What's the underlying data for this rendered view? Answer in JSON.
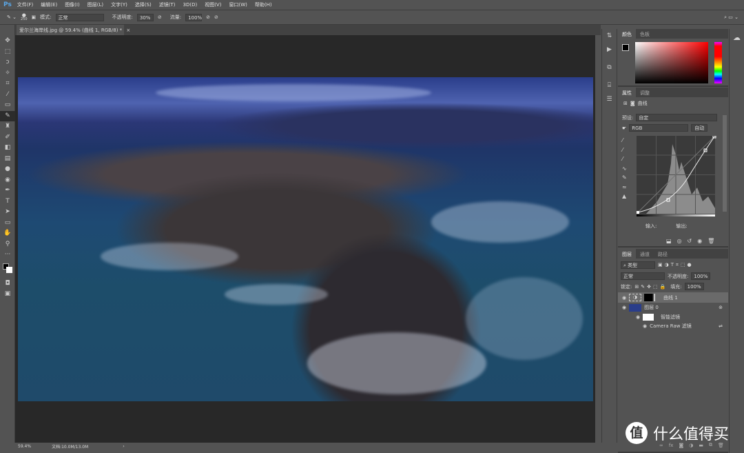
{
  "app": {
    "logo": "Ps"
  },
  "menu": [
    "文件(F)",
    "编辑(E)",
    "图像(I)",
    "图层(L)",
    "文字(Y)",
    "选择(S)",
    "滤镜(T)",
    "3D(D)",
    "视图(V)",
    "窗口(W)",
    "帮助(H)"
  ],
  "options": {
    "brush_size": "250",
    "mode_label": "模式:",
    "mode_value": "正常",
    "opacity_label": "不透明度:",
    "opacity_value": "30%",
    "flow_label": "流量:",
    "flow_value": "100%"
  },
  "document": {
    "tab_title": "爱尔兰海岸线.jpg @ 59.4% (曲线 1, RGB/8) *",
    "close": "×"
  },
  "status": {
    "zoom": "59.4%",
    "doc": "文档:10.0M/13.0M",
    "arrow": "›"
  },
  "color_panel": {
    "tabs": [
      "颜色",
      "色板"
    ]
  },
  "properties": {
    "tabs": [
      "属性",
      "调整"
    ],
    "title": "曲线",
    "preset_label": "预设:",
    "preset_value": "自定",
    "channel": "RGB",
    "auto": "自动",
    "input_label": "输入:",
    "output_label": "输出:"
  },
  "layers_panel": {
    "tabs": [
      "图层",
      "通道",
      "路径"
    ],
    "filter": "类型",
    "blend": "正常",
    "opacity_label": "不透明度:",
    "opacity_value": "100%",
    "lock_label": "锁定:",
    "fill_label": "填充:",
    "fill_value": "100%",
    "layers": [
      {
        "name": "曲线 1",
        "type": "adjustment",
        "selected": true
      },
      {
        "name": "图层 0",
        "type": "smart"
      },
      {
        "name": "智能滤镜",
        "type": "filter-mask"
      },
      {
        "name": "Camera Raw 滤镜",
        "type": "filter"
      }
    ]
  },
  "watermark": {
    "glyph": "值",
    "text": "什么值得买"
  },
  "colors": {
    "accent": "#5aa7e8",
    "panel": "#535353",
    "canvas": "#282828"
  }
}
